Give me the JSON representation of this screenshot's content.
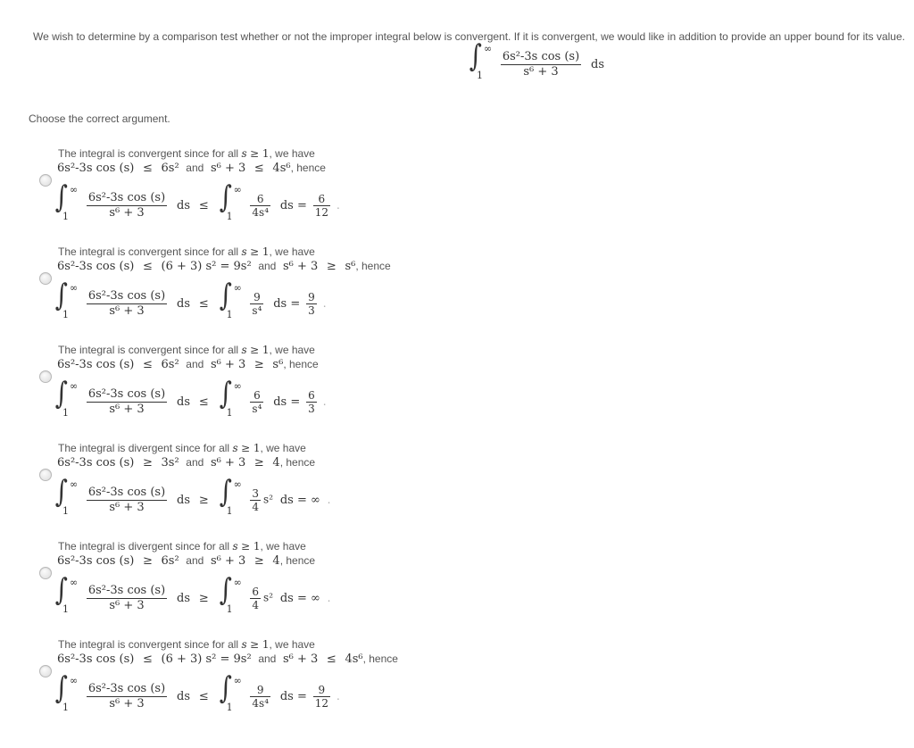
{
  "intro_text": "We wish to determine by a comparison test whether or not the improper integral below is convergent. If it is convergent, we would like in addition to provide an upper bound for its value.",
  "main_integral": {
    "upper": "∞",
    "lower": "1",
    "numerator": "6s²-3s cos (s)",
    "denominator": "s⁶ + 3",
    "differential": "ds"
  },
  "prompt": "Choose the correct argument.",
  "options": [
    {
      "selected": false,
      "line1_prefix": "The integral is convergent since for all",
      "line1_var": "s",
      "line1_cond": "≥ 1",
      "line1_suffix": ", we have",
      "ineq1_lhs": "6s²-3s cos (s)",
      "ineq1_rel": "≤",
      "ineq1_rhs": "6s²",
      "and": "and",
      "ineq2_lhs": "s⁶ + 3",
      "ineq2_rel": "≤",
      "ineq2_rhs": "4s⁶",
      "hence": ", hence",
      "compare_rel": "≤",
      "cmp_num": "6",
      "cmp_den": "4s⁴",
      "cmp_tail": "",
      "result_eq": "ds =",
      "result_num": "6",
      "result_den": "12",
      "result_plain": ""
    },
    {
      "selected": false,
      "line1_prefix": "The integral is convergent since for all",
      "line1_var": "s",
      "line1_cond": "≥ 1",
      "line1_suffix": ", we have",
      "ineq1_lhs": "6s²-3s cos (s)",
      "ineq1_rel": "≤",
      "ineq1_rhs": "(6 + 3) s² = 9s²",
      "and": "and",
      "ineq2_lhs": "s⁶ + 3",
      "ineq2_rel": "≥",
      "ineq2_rhs": "s⁶",
      "hence": ", hence",
      "compare_rel": "≤",
      "cmp_num": "9",
      "cmp_den": "s⁴",
      "cmp_tail": "",
      "result_eq": "ds =",
      "result_num": "9",
      "result_den": "3",
      "result_plain": ""
    },
    {
      "selected": false,
      "line1_prefix": "The integral is convergent since for all",
      "line1_var": "s",
      "line1_cond": "≥ 1",
      "line1_suffix": ", we have",
      "ineq1_lhs": "6s²-3s cos (s)",
      "ineq1_rel": "≤",
      "ineq1_rhs": "6s²",
      "and": "and",
      "ineq2_lhs": "s⁶ + 3",
      "ineq2_rel": "≥",
      "ineq2_rhs": "s⁶",
      "hence": ", hence",
      "compare_rel": "≤",
      "cmp_num": "6",
      "cmp_den": "s⁴",
      "cmp_tail": "",
      "result_eq": "ds =",
      "result_num": "6",
      "result_den": "3",
      "result_plain": ""
    },
    {
      "selected": false,
      "line1_prefix": "The integral is divergent since for all",
      "line1_var": "s",
      "line1_cond": "≥ 1",
      "line1_suffix": ", we have",
      "ineq1_lhs": "6s²-3s cos (s)",
      "ineq1_rel": "≥",
      "ineq1_rhs": "3s²",
      "and": "and",
      "ineq2_lhs": "s⁶ + 3",
      "ineq2_rel": "≥",
      "ineq2_rhs": "4",
      "hence": ", hence",
      "compare_rel": "≥",
      "cmp_num": "3",
      "cmp_den": "4",
      "cmp_tail": "s²",
      "result_eq": "ds = ∞",
      "result_num": "",
      "result_den": "",
      "result_plain": ""
    },
    {
      "selected": false,
      "line1_prefix": "The integral is divergent since for all",
      "line1_var": "s",
      "line1_cond": "≥ 1",
      "line1_suffix": ", we have",
      "ineq1_lhs": "6s²-3s cos (s)",
      "ineq1_rel": "≥",
      "ineq1_rhs": "6s²",
      "and": "and",
      "ineq2_lhs": "s⁶ + 3",
      "ineq2_rel": "≥",
      "ineq2_rhs": "4",
      "hence": ", hence",
      "compare_rel": "≥",
      "cmp_num": "6",
      "cmp_den": "4",
      "cmp_tail": "s²",
      "result_eq": "ds = ∞",
      "result_num": "",
      "result_den": "",
      "result_plain": ""
    },
    {
      "selected": false,
      "line1_prefix": "The integral is convergent since for all",
      "line1_var": "s",
      "line1_cond": "≥ 1",
      "line1_suffix": ", we have",
      "ineq1_lhs": "6s²-3s cos (s)",
      "ineq1_rel": "≤",
      "ineq1_rhs": "(6 + 3) s² = 9s²",
      "and": "and",
      "ineq2_lhs": "s⁶ + 3",
      "ineq2_rel": "≤",
      "ineq2_rhs": "4s⁶",
      "hence": ", hence",
      "compare_rel": "≤",
      "cmp_num": "9",
      "cmp_den": "4s⁴",
      "cmp_tail": "",
      "result_eq": "ds =",
      "result_num": "9",
      "result_den": "12",
      "result_plain": ""
    }
  ]
}
